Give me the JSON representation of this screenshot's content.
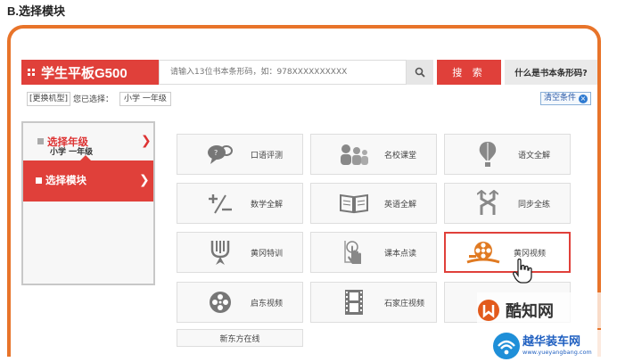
{
  "section_title": "B.选择模块",
  "header": {
    "device_title": "学生平板G500",
    "search_placeholder": "请输入13位书本条形码，如：978XXXXXXXXXX",
    "search_button": "搜 索",
    "barcode_help": "什么是书本条形码?"
  },
  "selection": {
    "change_device": "[更换机型]",
    "label": "您已选择：",
    "value": "小学 一年级",
    "clear": "清空条件"
  },
  "left_panel": {
    "year_title": "选择年级",
    "year_value": "小学 一年级",
    "module_title": "选择模块"
  },
  "modules": [
    {
      "label": "口语评测",
      "icon": "speech-bubble-icon"
    },
    {
      "label": "名校课堂",
      "icon": "classroom-icon"
    },
    {
      "label": "语文全解",
      "icon": "balloon-icon"
    },
    {
      "label": "数学全解",
      "icon": "math-symbols-icon"
    },
    {
      "label": "英语全解",
      "icon": "open-book-icon"
    },
    {
      "label": "同步全练",
      "icon": "arrows-icon"
    },
    {
      "label": "黄冈特训",
      "icon": "trophy-icon"
    },
    {
      "label": "课本点读",
      "icon": "touch-hand-icon"
    },
    {
      "label": "黄冈视频",
      "icon": "film-reel-icon",
      "selected": true
    },
    {
      "label": "启东视频",
      "icon": "film-reel-circle-icon"
    },
    {
      "label": "石家庄视频",
      "icon": "film-strip-icon"
    },
    {
      "label": "新东方在线",
      "icon": ""
    }
  ],
  "watermarks": {
    "site1": "酷知网",
    "site2": "越华装车网",
    "site2_url": "www.yueyangbang.com"
  },
  "colors": {
    "accent": "#e0403a",
    "frame": "#e8742a",
    "link": "#2a5aa8"
  }
}
